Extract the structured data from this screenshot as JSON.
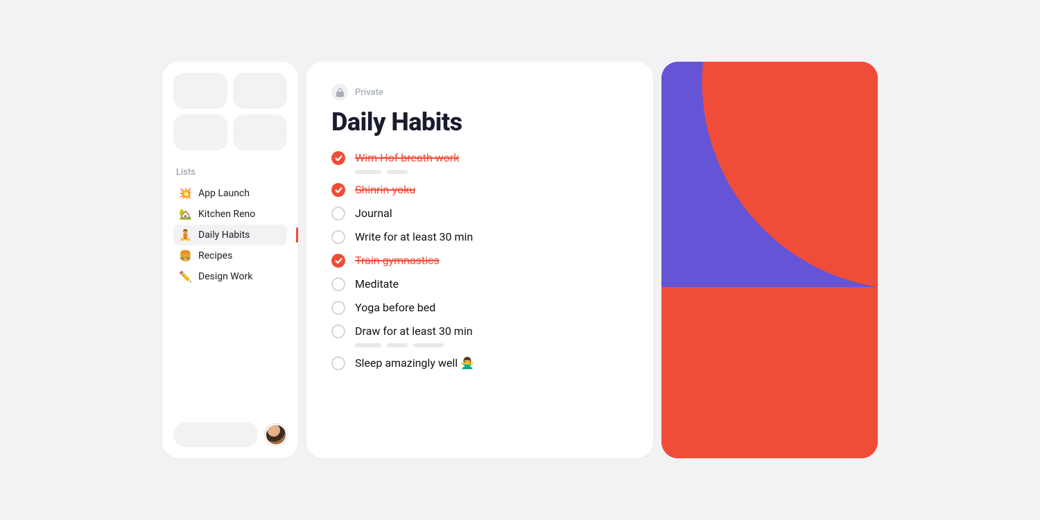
{
  "sidebar": {
    "section_label": "Lists",
    "items": [
      {
        "emoji": "💥",
        "label": "App Launch",
        "active": false
      },
      {
        "emoji": "🏡",
        "label": "Kitchen Reno",
        "active": false
      },
      {
        "emoji": "🧘",
        "label": "Daily Habits",
        "active": true
      },
      {
        "emoji": "🍔",
        "label": "Recipes",
        "active": false
      },
      {
        "emoji": "✏️",
        "label": "Design Work",
        "active": false
      }
    ]
  },
  "main": {
    "privacy_label": "Private",
    "title": "Daily Habits",
    "tasks": [
      {
        "label": "Wim Hof breath work",
        "done": true,
        "meta": true
      },
      {
        "label": "Shinrin-yoku",
        "done": true,
        "meta": false
      },
      {
        "label": "Journal",
        "done": false,
        "meta": false
      },
      {
        "label": "Write for at least 30 min",
        "done": false,
        "meta": false
      },
      {
        "label": "Train gymnastics",
        "done": true,
        "meta": false
      },
      {
        "label": "Meditate",
        "done": false,
        "meta": false
      },
      {
        "label": "Yoga before bed",
        "done": false,
        "meta": false
      },
      {
        "label": "Draw for at least 30 min",
        "done": false,
        "meta": true
      },
      {
        "label": "Sleep amazingly well 🙅‍♂️",
        "done": false,
        "meta": false
      }
    ]
  },
  "colors": {
    "accent": "#f04d38",
    "decor_bg": "#6554d6",
    "decor_shape": "#f04d38"
  }
}
